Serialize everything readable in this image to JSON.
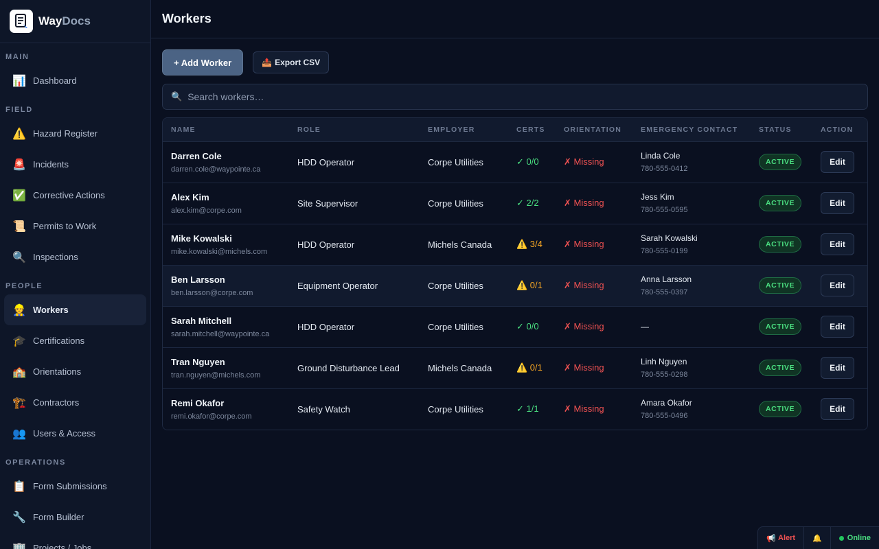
{
  "brand": {
    "name_prefix": "Way",
    "name_suffix": "Docs"
  },
  "sidebar": {
    "sections": [
      {
        "label": "MAIN",
        "items": [
          {
            "icon": "📊",
            "icon_name": "chart-icon",
            "label": "Dashboard"
          }
        ]
      },
      {
        "label": "FIELD",
        "items": [
          {
            "icon": "⚠️",
            "icon_name": "warning-icon",
            "label": "Hazard Register"
          },
          {
            "icon": "🚨",
            "icon_name": "siren-icon",
            "label": "Incidents"
          },
          {
            "icon": "✅",
            "icon_name": "check-icon",
            "label": "Corrective Actions"
          },
          {
            "icon": "📜",
            "icon_name": "scroll-icon",
            "label": "Permits to Work"
          },
          {
            "icon": "🔍",
            "icon_name": "magnifier-icon",
            "label": "Inspections"
          }
        ]
      },
      {
        "label": "PEOPLE",
        "items": [
          {
            "icon": "👷",
            "icon_name": "worker-icon",
            "label": "Workers",
            "active": true
          },
          {
            "icon": "🎓",
            "icon_name": "graduation-cap-icon",
            "label": "Certifications"
          },
          {
            "icon": "🏫",
            "icon_name": "school-icon",
            "label": "Orientations"
          },
          {
            "icon": "🏗️",
            "icon_name": "crane-icon",
            "label": "Contractors"
          },
          {
            "icon": "👥",
            "icon_name": "users-icon",
            "label": "Users & Access"
          }
        ]
      },
      {
        "label": "OPERATIONS",
        "items": [
          {
            "icon": "📋",
            "icon_name": "clipboard-icon",
            "label": "Form Submissions"
          },
          {
            "icon": "🔧",
            "icon_name": "wrench-icon",
            "label": "Form Builder"
          },
          {
            "icon": "🏢",
            "icon_name": "building-icon",
            "label": "Projects / Jobs"
          }
        ]
      }
    ]
  },
  "header": {
    "title": "Workers"
  },
  "toolbar": {
    "add_label": "+ Add Worker",
    "export_icon": "📤",
    "export_label": "Export CSV"
  },
  "search": {
    "icon": "🔍",
    "placeholder": "Search workers…"
  },
  "table": {
    "columns": [
      "NAME",
      "ROLE",
      "EMPLOYER",
      "CERTS",
      "ORIENTATION",
      "EMERGENCY CONTACT",
      "STATUS",
      "ACTION"
    ],
    "rows": [
      {
        "name": "Darren Cole",
        "email": "darren.cole@waypointe.ca",
        "role": "HDD Operator",
        "employer": "Corpe Utilities",
        "certs": "✓ 0/0",
        "certs_state": "ok",
        "orientation": "✗ Missing",
        "contact_name": "Linda Cole",
        "contact_phone": "780-555-0412",
        "status": "ACTIVE",
        "action": "Edit"
      },
      {
        "name": "Alex Kim",
        "email": "alex.kim@corpe.com",
        "role": "Site Supervisor",
        "employer": "Corpe Utilities",
        "certs": "✓ 2/2",
        "certs_state": "ok",
        "orientation": "✗ Missing",
        "contact_name": "Jess Kim",
        "contact_phone": "780-555-0595",
        "status": "ACTIVE",
        "action": "Edit"
      },
      {
        "name": "Mike Kowalski",
        "email": "mike.kowalski@michels.com",
        "role": "HDD Operator",
        "employer": "Michels Canada",
        "certs": "⚠️ 3/4",
        "certs_state": "warn",
        "orientation": "✗ Missing",
        "contact_name": "Sarah Kowalski",
        "contact_phone": "780-555-0199",
        "status": "ACTIVE",
        "action": "Edit"
      },
      {
        "name": "Ben Larsson",
        "email": "ben.larsson@corpe.com",
        "role": "Equipment Operator",
        "employer": "Corpe Utilities",
        "certs": "⚠️ 0/1",
        "certs_state": "warn",
        "orientation": "✗ Missing",
        "contact_name": "Anna Larsson",
        "contact_phone": "780-555-0397",
        "status": "ACTIVE",
        "action": "Edit",
        "highlighted": true
      },
      {
        "name": "Sarah Mitchell",
        "email": "sarah.mitchell@waypointe.ca",
        "role": "HDD Operator",
        "employer": "Corpe Utilities",
        "certs": "✓ 0/0",
        "certs_state": "ok",
        "orientation": "✗ Missing",
        "contact_name": "—",
        "contact_phone": "",
        "status": "ACTIVE",
        "action": "Edit"
      },
      {
        "name": "Tran Nguyen",
        "email": "tran.nguyen@michels.com",
        "role": "Ground Disturbance Lead",
        "employer": "Michels Canada",
        "certs": "⚠️ 0/1",
        "certs_state": "warn",
        "orientation": "✗ Missing",
        "contact_name": "Linh Nguyen",
        "contact_phone": "780-555-0298",
        "status": "ACTIVE",
        "action": "Edit"
      },
      {
        "name": "Remi Okafor",
        "email": "remi.okafor@corpe.com",
        "role": "Safety Watch",
        "employer": "Corpe Utilities",
        "certs": "✓ 1/1",
        "certs_state": "ok",
        "orientation": "✗ Missing",
        "contact_name": "Amara Okafor",
        "contact_phone": "780-555-0496",
        "status": "ACTIVE",
        "action": "Edit"
      }
    ]
  },
  "statusbar": {
    "alert_icon": "📢",
    "alert_label": "Alert",
    "bell_icon": "🔔",
    "online_label": "Online"
  },
  "colors": {
    "background": "#0a1020",
    "sidebar": "#0e1628",
    "accent_button": "#4b6384",
    "status_ok": "#4ade80",
    "status_warn": "#f5a524",
    "status_error": "#f05252"
  }
}
